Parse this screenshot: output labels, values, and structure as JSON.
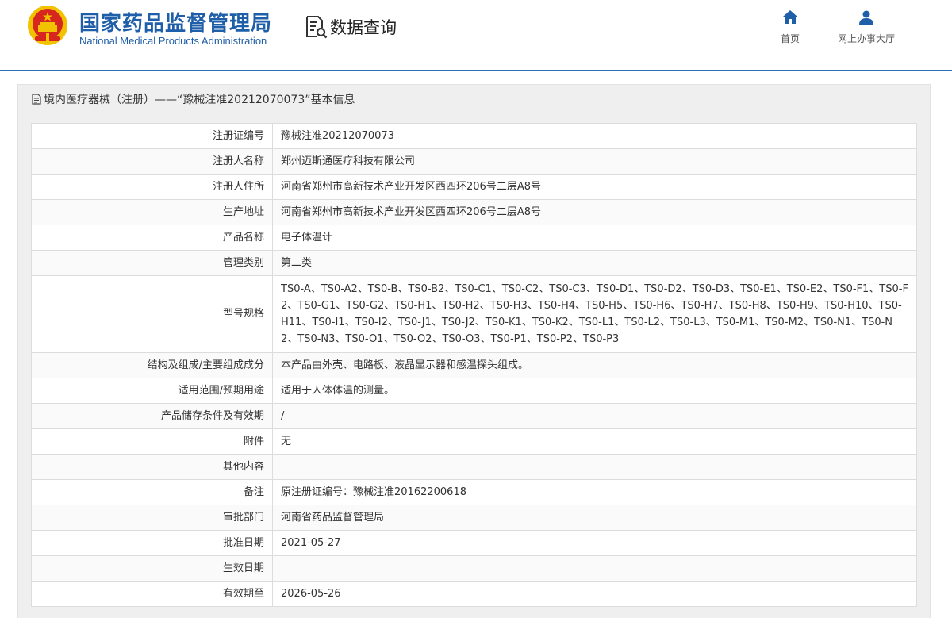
{
  "header": {
    "logo_cn": "国家药品监督管理局",
    "logo_en": "National Medical Products Administration",
    "query_label": "数据查询",
    "nav": [
      {
        "label": "首页",
        "icon": "home-icon"
      },
      {
        "label": "网上办事大厅",
        "icon": "user-icon"
      }
    ]
  },
  "panel": {
    "title": "境内医疗器械（注册）——“豫械注准20212070073”基本信息"
  },
  "rows": [
    {
      "label": "注册证编号",
      "value": "豫械注准20212070073"
    },
    {
      "label": "注册人名称",
      "value": "郑州迈斯通医疗科技有限公司"
    },
    {
      "label": "注册人住所",
      "value": "河南省郑州市高新技术产业开发区西四环206号二层A8号"
    },
    {
      "label": "生产地址",
      "value": "河南省郑州市高新技术产业开发区西四环206号二层A8号"
    },
    {
      "label": "产品名称",
      "value": "电子体温计"
    },
    {
      "label": "管理类别",
      "value": "第二类"
    },
    {
      "label": "型号规格",
      "value": "TS0-A、TS0-A2、TS0-B、TS0-B2、TS0-C1、TS0-C2、TS0-C3、TS0-D1、TS0-D2、TS0-D3、TS0-E1、TS0-E2、TS0-F1、TS0-F2、TS0-G1、TS0-G2、TS0-H1、TS0-H2、TS0-H3、TS0-H4、TS0-H5、TS0-H6、TS0-H7、TS0-H8、TS0-H9、TS0-H10、TS0-H11、TS0-I1、TS0-I2、TS0-J1、TS0-J2、TS0-K1、TS0-K2、TS0-L1、TS0-L2、TS0-L3、TS0-M1、TS0-M2、TS0-N1、TS0-N2、TS0-N3、TS0-O1、TS0-O2、TS0-O3、TS0-P1、TS0-P2、TS0-P3"
    },
    {
      "label": "结构及组成/主要组成成分",
      "value": "本产品由外壳、电路板、液晶显示器和感温探头组成。"
    },
    {
      "label": "适用范围/预期用途",
      "value": "适用于人体体温的测量。"
    },
    {
      "label": "产品储存条件及有效期",
      "value": "/"
    },
    {
      "label": "附件",
      "value": "无"
    },
    {
      "label": "其他内容",
      "value": ""
    },
    {
      "label": "备注",
      "value": "原注册证编号：豫械注准20162200618"
    },
    {
      "label": "审批部门",
      "value": "河南省药品监督管理局"
    },
    {
      "label": "批准日期",
      "value": "2021-05-27"
    },
    {
      "label": "生效日期",
      "value": ""
    },
    {
      "label": "有效期至",
      "value": "2026-05-26"
    }
  ],
  "colors": {
    "brand_blue": "#1f5ea8",
    "emblem_red": "#d7261f",
    "emblem_gold": "#f2c200"
  }
}
